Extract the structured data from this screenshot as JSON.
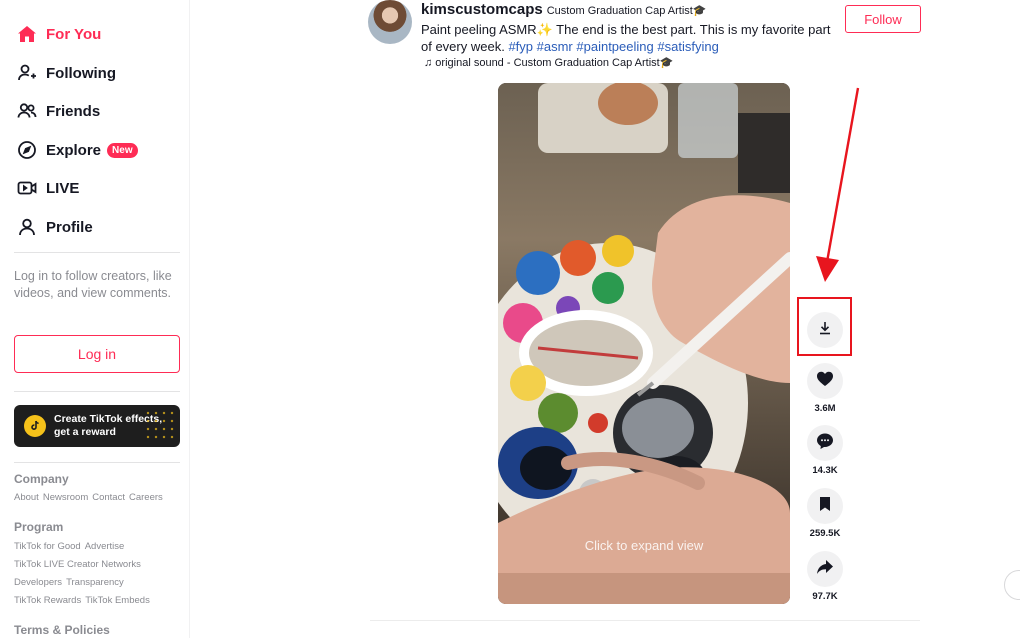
{
  "sidebar": {
    "nav": [
      {
        "label": "For You",
        "icon": "home-icon",
        "active": true
      },
      {
        "label": "Following",
        "icon": "following-icon"
      },
      {
        "label": "Friends",
        "icon": "friends-icon"
      },
      {
        "label": "Explore",
        "icon": "compass-icon",
        "badge": "New"
      },
      {
        "label": "LIVE",
        "icon": "live-icon"
      },
      {
        "label": "Profile",
        "icon": "profile-icon"
      }
    ],
    "login_hint": "Log in to follow creators, like videos, and view comments.",
    "login_button": "Log in",
    "effects_card": {
      "line1": "Create TikTok effects,",
      "line2": "get a reward"
    },
    "footer": {
      "company_title": "Company",
      "company_links": [
        "About",
        "Newsroom",
        "Contact",
        "Careers"
      ],
      "program_title": "Program",
      "program_rows": [
        [
          "TikTok for Good",
          "Advertise"
        ],
        [
          "TikTok LIVE Creator Networks"
        ],
        [
          "Developers",
          "Transparency"
        ],
        [
          "TikTok Rewards",
          "TikTok Embeds"
        ]
      ],
      "terms_title": "Terms & Policies"
    }
  },
  "post": {
    "username": "kimscustomcaps",
    "nickname": "Custom Graduation Cap Artist🎓",
    "caption_text": "Paint peeling ASMR✨ The end is the best part. This is my favorite part of every week. ",
    "hashtags": [
      "#fyp",
      "#asmr",
      "#paintpeeling",
      "#satisfying"
    ],
    "sound": "♫ original sound - Custom Graduation Cap Artist🎓",
    "follow_label": "Follow",
    "video_hint": "Click to expand view"
  },
  "actions": [
    {
      "name": "download",
      "icon": "download-icon",
      "count": ""
    },
    {
      "name": "like",
      "icon": "heart-icon",
      "count": "3.6M"
    },
    {
      "name": "comment",
      "icon": "comment-icon",
      "count": "14.3K"
    },
    {
      "name": "save",
      "icon": "bookmark-icon",
      "count": "259.5K"
    },
    {
      "name": "share",
      "icon": "share-icon",
      "count": "97.7K"
    }
  ],
  "colors": {
    "accent": "#fe2c55",
    "annotation": "#e8151e",
    "hashtag": "#2b5db9"
  }
}
